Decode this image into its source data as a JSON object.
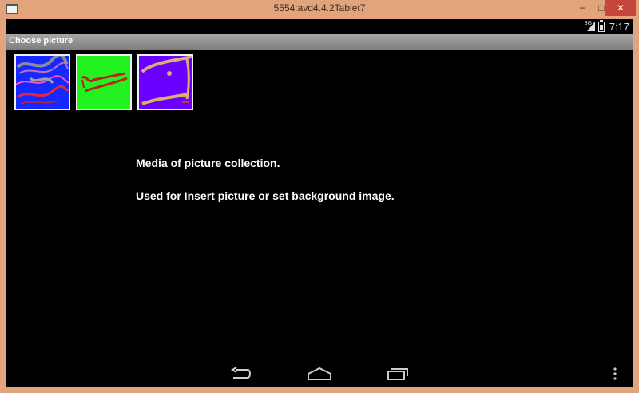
{
  "window": {
    "title": "5554:avd4.4.2Tablet7",
    "minimize_glyph": "−",
    "maximize_glyph": "□",
    "close_glyph": "✕"
  },
  "statusbar": {
    "network_label": "3G",
    "time": "7:17"
  },
  "actionbar": {
    "title": "Choose picture"
  },
  "thumbnails": [
    {
      "name": "picture-1",
      "background": "#1428ff"
    },
    {
      "name": "picture-2",
      "background": "#22f21f"
    },
    {
      "name": "picture-3",
      "background": "#6a00ff"
    }
  ],
  "info": {
    "line1": "Media of picture collection.",
    "line2": "Used for Insert picture or set background image."
  },
  "navbar": {
    "icons": [
      "back-icon",
      "home-icon",
      "recent-apps-icon",
      "overflow-menu-icon"
    ]
  }
}
